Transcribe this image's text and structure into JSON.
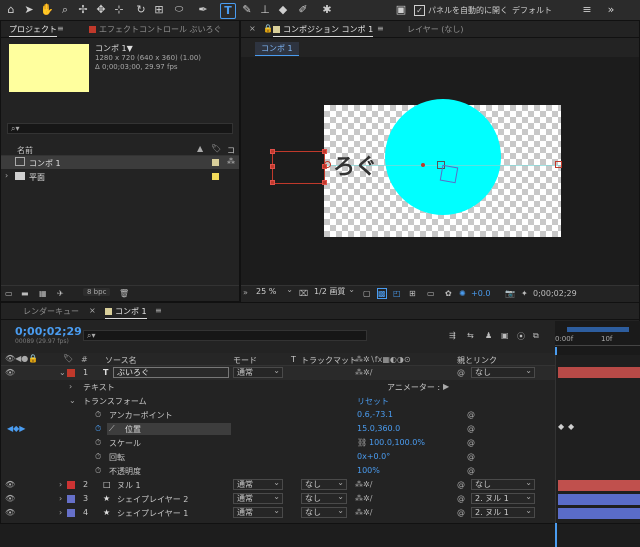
{
  "toolbar": {
    "panel_auto_open_label": "パネルを自動的に開く",
    "workspace_label": "デフォルト"
  },
  "project_panel": {
    "tab_project": "プロジェクト",
    "tab_effect_controls": "エフェクトコントロール ぶいろぐ",
    "comp_name": "コンポ 1▼",
    "comp_info_line1": "1280 x 720 (640 x 360) (1.00)",
    "comp_info_line2": "Δ 0;00;03;00, 29.97 fps",
    "thumb_color": "#ffff9e",
    "list_header_name": "名前",
    "list_header_more": "コ",
    "items": [
      {
        "label": "コンポ 1",
        "color": "#d9cf9a"
      },
      {
        "label": "平面",
        "color": "#f2da5a"
      }
    ],
    "bpc_label": "8 bpc"
  },
  "comp_viewer": {
    "tab_label": "コンポジション コンポ 1",
    "layer_tab_label": "レイヤー (なし)",
    "breadcrumb": "コンポ 1",
    "canvas_text": "ろぐ",
    "circle_color": "#00ffff",
    "zoom_label": "25 %",
    "quality_label": "1/2 画質",
    "exposure_value": "+0.0",
    "timecode_label": "0;00;02;29"
  },
  "timeline": {
    "tab_render_queue": "レンダーキュー",
    "tab_comp": "コンポ 1",
    "timecode": "0;00;02;29",
    "frame_info": "00089 (29.97 fps)",
    "col_source_name": "ソース名",
    "col_mode": "モード",
    "col_t": "T",
    "col_track_matte": "トラックマット",
    "col_parent": "親とリンク",
    "ruler_labels": [
      "0:00f",
      "10f"
    ],
    "text_layer": {
      "number": "1",
      "name": "ぶいろぐ",
      "mode": "通常",
      "parent": "なし"
    },
    "text_group": {
      "label": "テキスト",
      "animator_label": "アニメーター :"
    },
    "transform": {
      "label": "トランスフォーム",
      "reset_label": "リセット",
      "anchor_label": "アンカーポイント",
      "anchor_value": "0.6,-73.1",
      "position_label": "位置",
      "position_value": "15.0,360.0",
      "scale_label": "スケール",
      "scale_value": "100.0,100.0%",
      "rotation_label": "回転",
      "rotation_value": "0x+0.0°",
      "opacity_label": "不透明度",
      "opacity_value": "100%"
    },
    "layers": [
      {
        "number": "2",
        "name": "ヌル 1",
        "mode": "通常",
        "matte": "なし",
        "parent": "なし",
        "color": "#cc3333",
        "bar_color": "#c0504d"
      },
      {
        "number": "3",
        "name": "シェイプレイヤー 2",
        "mode": "通常",
        "matte": "なし",
        "parent": "2. ヌル 1",
        "color": "#6670c9",
        "bar_color": "#5a6cc9"
      },
      {
        "number": "4",
        "name": "シェイプレイヤー 1",
        "mode": "通常",
        "matte": "なし",
        "parent": "2. ヌル 1",
        "color": "#6670c9",
        "bar_color": "#5a6cc9"
      }
    ]
  }
}
